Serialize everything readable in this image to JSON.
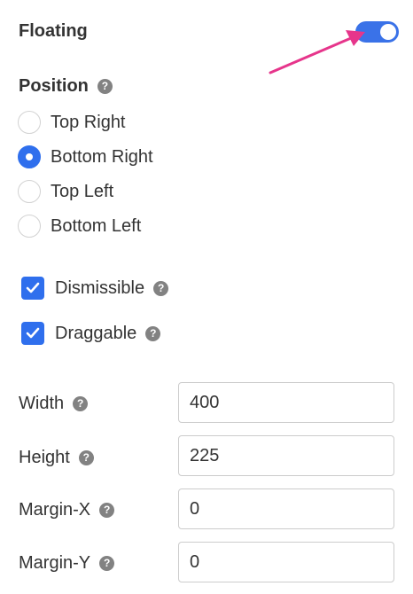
{
  "floating": {
    "label": "Floating",
    "enabled": true,
    "accent_color": "#3a72e8",
    "annotation_color": "#e6358b"
  },
  "position": {
    "title": "Position",
    "help_icon": "question-mark-icon",
    "options": [
      {
        "label": "Top Right",
        "selected": false
      },
      {
        "label": "Bottom Right",
        "selected": true
      },
      {
        "label": "Top Left",
        "selected": false
      },
      {
        "label": "Bottom Left",
        "selected": false
      }
    ]
  },
  "options": {
    "dismissible": {
      "label": "Dismissible",
      "checked": true
    },
    "draggable": {
      "label": "Draggable",
      "checked": true
    }
  },
  "fields": {
    "width": {
      "label": "Width",
      "value": "400"
    },
    "height": {
      "label": "Height",
      "value": "225"
    },
    "margin_x": {
      "label": "Margin-X",
      "value": "0"
    },
    "margin_y": {
      "label": "Margin-Y",
      "value": "0"
    }
  },
  "help_glyph": "?"
}
